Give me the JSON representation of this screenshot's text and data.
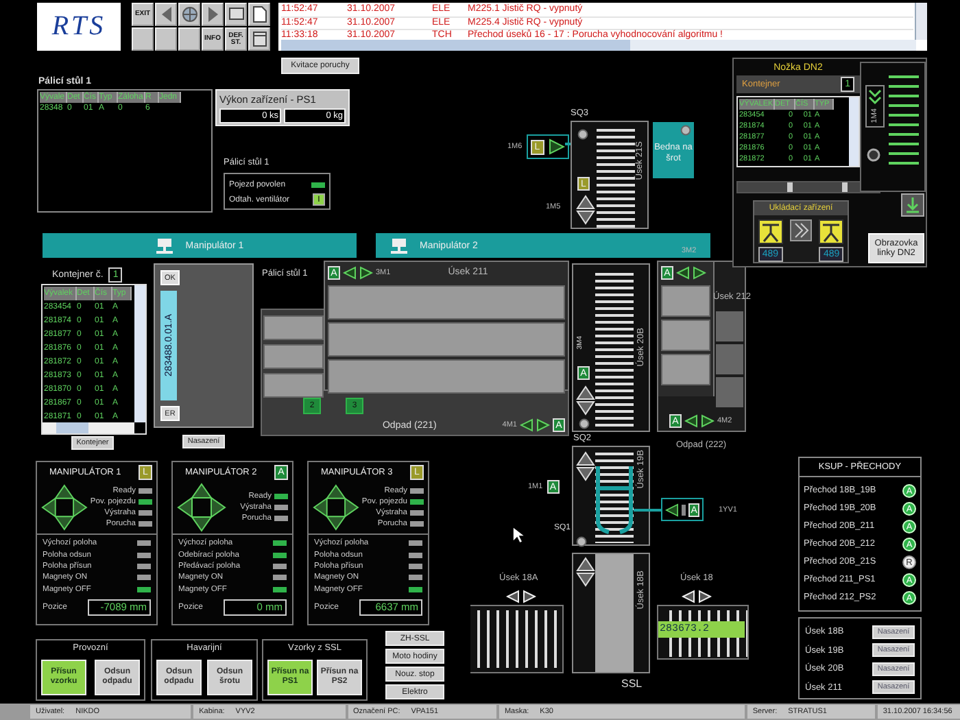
{
  "toolbar": {
    "logo": "RTS",
    "buttons": [
      {
        "kind": "text",
        "label": "EXIT"
      },
      {
        "kind": "left"
      },
      {
        "kind": "globe"
      },
      {
        "kind": "right"
      },
      {
        "kind": "screen"
      },
      {
        "kind": "page"
      },
      {
        "kind": "plain"
      },
      {
        "kind": "plain"
      },
      {
        "kind": "plain"
      },
      {
        "kind": "text",
        "label": "INFO"
      },
      {
        "kind": "text",
        "label": "DEF. ST."
      },
      {
        "kind": "frame"
      }
    ]
  },
  "alarms": [
    {
      "time": "11:52:47",
      "date": "31.10.2007",
      "source": "ELE",
      "message": "M225.1 Jistič RQ  - vypnutý"
    },
    {
      "time": "11:52:47",
      "date": "31.10.2007",
      "source": "ELE",
      "message": "M225.4 Jistič RQ  - vypnutý"
    },
    {
      "time": "11:33:18",
      "date": "31.10.2007",
      "source": "TCH",
      "message": "Přechod úseků 16 - 17 : Porucha vyhodnocování algoritmu !"
    }
  ],
  "ack_button": "Kvitace poruchy",
  "table_1": {
    "title": "Pálicí stůl 1",
    "columns": [
      "Vývale",
      "Det",
      "Čís",
      "Typ",
      "Záloha",
      "R",
      "Jedn"
    ],
    "rows": [
      [
        "28348",
        "0",
        "01",
        "A",
        "0",
        "6"
      ]
    ]
  },
  "output_box": {
    "title": "Výkon zařízení - PS1",
    "values": [
      "0 ks",
      "0 kg"
    ]
  },
  "table_1_status": {
    "title": "Pálicí stůl 1",
    "items": [
      {
        "kind": "lamp",
        "label": "Pojezd povolen",
        "on": true
      },
      {
        "kind": "switch",
        "label": "Odtah. ventilátor",
        "text": "I",
        "on": true
      }
    ]
  },
  "manipulator_bars": [
    "Manipulátor 1",
    "Manipulátor 2"
  ],
  "container": {
    "label": "Kontejner č.",
    "number": "1",
    "columns": [
      "Vývalek",
      "Det",
      "Čís",
      "Typ"
    ],
    "rows": [
      [
        "283454",
        "0",
        "01",
        "A"
      ],
      [
        "281874",
        "0",
        "01",
        "A"
      ],
      [
        "281877",
        "0",
        "01",
        "A"
      ],
      [
        "281876",
        "0",
        "01",
        "A"
      ],
      [
        "281872",
        "0",
        "01",
        "A"
      ],
      [
        "281873",
        "0",
        "01",
        "A"
      ],
      [
        "281870",
        "0",
        "01",
        "A"
      ],
      [
        "281867",
        "0",
        "01",
        "A"
      ],
      [
        "281871",
        "0",
        "01",
        "A"
      ]
    ],
    "button": "Kontejner"
  },
  "slot": {
    "top": "OK",
    "code": "283488.0.01.A",
    "bottom": "ER",
    "button": "Nasazení"
  },
  "section_211": {
    "title": "Pálicí stůl 1",
    "mode": "A",
    "motor": "3M1",
    "name": "Úsek 211",
    "positions": [
      "2",
      "3"
    ],
    "waste": "Odpad (221)",
    "motor_out": "4M1",
    "mode_out": "A"
  },
  "sq3": {
    "sensor": "SQ3",
    "motor_in": "1M6",
    "mode_in": "L",
    "name": "Úsek 21S",
    "mode": "L",
    "motor": "1M5",
    "bin": "Bedna na šrot"
  },
  "conveyor_20b": {
    "name": "Úsek 20B",
    "motor": "3M4",
    "mode": "A",
    "sensor": "SQ2"
  },
  "section_212": {
    "motor": "3M2",
    "mode": "A",
    "name": "Úsek 212",
    "mode_out": "A",
    "motor_out": "4M2",
    "waste": "Odpad (222)"
  },
  "dn2": {
    "title": "Nožka DN2",
    "label": "Kontejner",
    "number": "1",
    "columns": [
      "VÝVALEK",
      "DET",
      "ČÍS",
      "TYP"
    ],
    "rows": [
      [
        "283454",
        "0",
        "01",
        "A"
      ],
      [
        "281874",
        "0",
        "01",
        "A"
      ],
      [
        "281877",
        "0",
        "01",
        "A"
      ],
      [
        "281876",
        "0",
        "01",
        "A"
      ],
      [
        "281872",
        "0",
        "01",
        "A"
      ]
    ],
    "motor": "1M4",
    "storage_title": "Ukládací zařízení",
    "counts": [
      "489",
      "489"
    ],
    "button": "Obrazovka linky DN2"
  },
  "manipulators": [
    {
      "title": "MANIPULÁTOR 1",
      "mode": "L",
      "status": [
        {
          "label": "Ready",
          "on": false
        },
        {
          "label": "Pov. pojezdu",
          "on": true
        },
        {
          "label": "Výstraha",
          "on": false
        },
        {
          "label": "Porucha",
          "on": false
        }
      ],
      "positions": [
        {
          "label": "Výchozí poloha",
          "on": false
        },
        {
          "label": "Poloha odsun",
          "on": false
        },
        {
          "label": "Poloha přísun",
          "on": false
        },
        {
          "label": "Magnety ON",
          "on": false
        },
        {
          "label": "Magnety OFF",
          "on": true
        }
      ],
      "position_label": "Pozice",
      "position": "-7089 mm"
    },
    {
      "title": "MANIPULÁTOR 2",
      "mode": "A",
      "status": [
        {
          "label": "Ready",
          "on": true
        },
        {
          "label": "Výstraha",
          "on": false
        },
        {
          "label": "Porucha",
          "on": false
        }
      ],
      "positions": [
        {
          "label": "Výchozí poloha",
          "on": true
        },
        {
          "label": "Odebírací poloha",
          "on": true
        },
        {
          "label": "Předávací poloha",
          "on": false
        },
        {
          "label": "Magnety ON",
          "on": false
        },
        {
          "label": "Magnety OFF",
          "on": true
        }
      ],
      "position_label": "Pozice",
      "position": "0 mm"
    },
    {
      "title": "MANIPULÁTOR 3",
      "mode": "L",
      "status": [
        {
          "label": "Ready",
          "on": false
        },
        {
          "label": "Pov. pojezdu",
          "on": true
        },
        {
          "label": "Výstraha",
          "on": false
        },
        {
          "label": "Porucha",
          "on": false
        }
      ],
      "positions": [
        {
          "label": "Výchozí poloha",
          "on": false
        },
        {
          "label": "Poloha odsun",
          "on": false
        },
        {
          "label": "Poloha přísun",
          "on": false
        },
        {
          "label": "Magnety ON",
          "on": false
        },
        {
          "label": "Magnety OFF",
          "on": true
        }
      ],
      "position_label": "Pozice",
      "position": "6637 mm"
    }
  ],
  "mode_groups": [
    {
      "title": "Provozní",
      "buttons": [
        {
          "label": "Přísun vzorku",
          "on": true
        },
        {
          "label": "Odsun odpadu",
          "on": false
        }
      ]
    },
    {
      "title": "Havarijní",
      "buttons": [
        {
          "label": "Odsun odpadu",
          "on": false
        },
        {
          "label": "Odsun šrotu",
          "on": false
        }
      ]
    },
    {
      "title": "Vzorky z SSL",
      "buttons": [
        {
          "label": "Přísun na PS1",
          "on": true
        },
        {
          "label": "Přísun na PS2",
          "on": false
        }
      ]
    }
  ],
  "side_buttons": [
    "ZH-SSL",
    "Moto hodiny",
    "Nouz. stop",
    "Elektro"
  ],
  "ssl": {
    "motor": "1M1",
    "mode": "A",
    "section_19b": "Úsek 19B",
    "sensor": "SQ1",
    "valve": "1YV1",
    "valve_mode": "A",
    "section_18b": "Úsek 18B",
    "section_18a": "Úsek 18A",
    "section_18": "Úsek 18",
    "reading": "283673.2",
    "title": "SSL"
  },
  "ksup": {
    "title": "KSUP - PŘECHODY",
    "items": [
      {
        "label": "Přechod 18B_19B",
        "state": "A"
      },
      {
        "label": "Přechod 19B_20B",
        "state": "A"
      },
      {
        "label": "Přechod 20B_211",
        "state": "A"
      },
      {
        "label": "Přechod 20B_212",
        "state": "A"
      },
      {
        "label": "Přechod 20B_21S",
        "state": "R"
      },
      {
        "label": "Přechod 211_PS1",
        "state": "A"
      },
      {
        "label": "Přechod 212_PS2",
        "state": "A"
      }
    ]
  },
  "sections": [
    {
      "label": "Úsek 18B",
      "button": "Nasazení"
    },
    {
      "label": "Úsek 19B",
      "button": "Nasazení"
    },
    {
      "label": "Úsek 20B",
      "button": "Nasazení"
    },
    {
      "label": "Úsek 211",
      "button": "Nasazení"
    }
  ],
  "status_bar": [
    {
      "label": "Uživatel:",
      "value": "NIKDO"
    },
    {
      "label": "Kabina:",
      "value": "VYV2"
    },
    {
      "label": "Označení PC:",
      "value": "VPA151"
    },
    {
      "label": "Maska:",
      "value": "K30"
    },
    {
      "label": "Server:",
      "value": "STRATUS1"
    },
    {
      "value": "31.10.2007 16:34:56"
    }
  ]
}
